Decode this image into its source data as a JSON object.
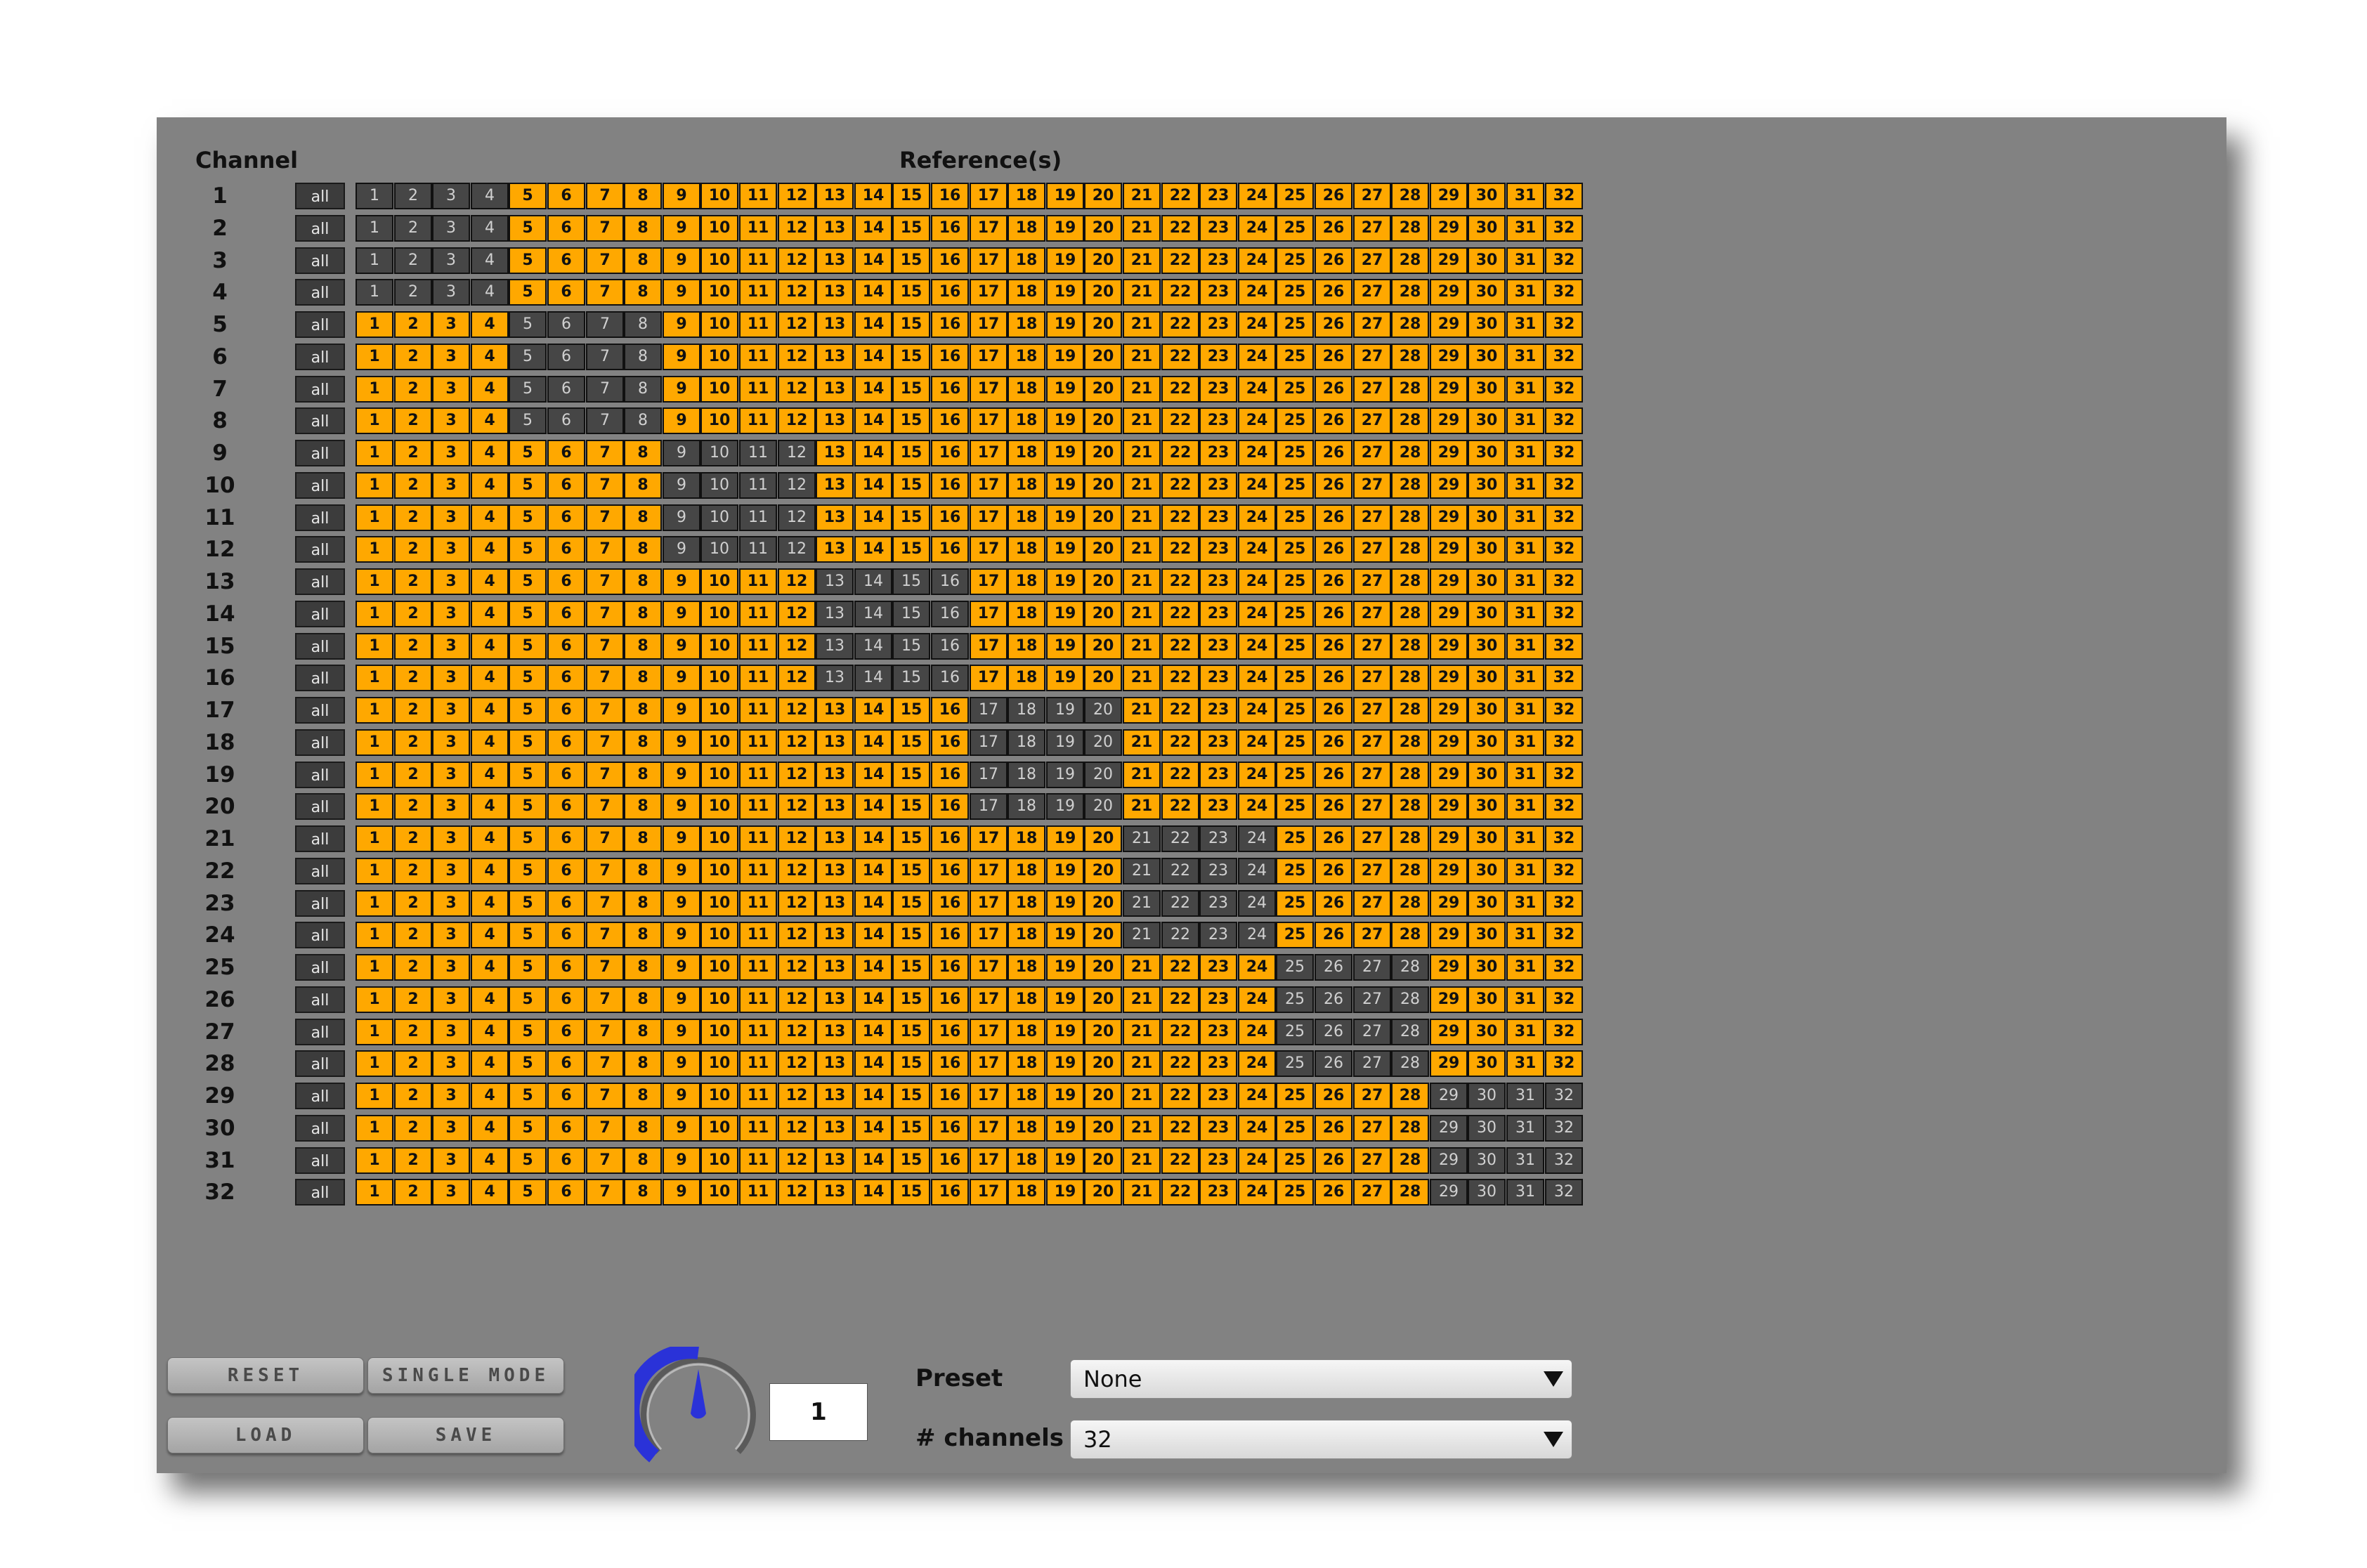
{
  "headers": {
    "channel": "Channel",
    "references": "Reference(s)"
  },
  "grid": {
    "num_channels": 32,
    "all_label": "all",
    "rows": [
      {
        "channel": "1",
        "off": [
          1,
          2,
          3,
          4
        ]
      },
      {
        "channel": "2",
        "off": [
          1,
          2,
          3,
          4
        ]
      },
      {
        "channel": "3",
        "off": [
          1,
          2,
          3,
          4
        ]
      },
      {
        "channel": "4",
        "off": [
          1,
          2,
          3,
          4
        ]
      },
      {
        "channel": "5",
        "off": [
          5,
          6,
          7,
          8
        ]
      },
      {
        "channel": "6",
        "off": [
          5,
          6,
          7,
          8
        ]
      },
      {
        "channel": "7",
        "off": [
          5,
          6,
          7,
          8
        ]
      },
      {
        "channel": "8",
        "off": [
          5,
          6,
          7,
          8
        ]
      },
      {
        "channel": "9",
        "off": [
          9,
          10,
          11,
          12
        ]
      },
      {
        "channel": "10",
        "off": [
          9,
          10,
          11,
          12
        ]
      },
      {
        "channel": "11",
        "off": [
          9,
          10,
          11,
          12
        ]
      },
      {
        "channel": "12",
        "off": [
          9,
          10,
          11,
          12
        ]
      },
      {
        "channel": "13",
        "off": [
          13,
          14,
          15,
          16
        ]
      },
      {
        "channel": "14",
        "off": [
          13,
          14,
          15,
          16
        ]
      },
      {
        "channel": "15",
        "off": [
          13,
          14,
          15,
          16
        ]
      },
      {
        "channel": "16",
        "off": [
          13,
          14,
          15,
          16
        ]
      },
      {
        "channel": "17",
        "off": [
          17,
          18,
          19,
          20
        ]
      },
      {
        "channel": "18",
        "off": [
          17,
          18,
          19,
          20
        ]
      },
      {
        "channel": "19",
        "off": [
          17,
          18,
          19,
          20
        ]
      },
      {
        "channel": "20",
        "off": [
          17,
          18,
          19,
          20
        ]
      },
      {
        "channel": "21",
        "off": [
          21,
          22,
          23,
          24
        ]
      },
      {
        "channel": "22",
        "off": [
          21,
          22,
          23,
          24
        ]
      },
      {
        "channel": "23",
        "off": [
          21,
          22,
          23,
          24
        ]
      },
      {
        "channel": "24",
        "off": [
          21,
          22,
          23,
          24
        ]
      },
      {
        "channel": "25",
        "off": [
          25,
          26,
          27,
          28
        ]
      },
      {
        "channel": "26",
        "off": [
          25,
          26,
          27,
          28
        ]
      },
      {
        "channel": "27",
        "off": [
          25,
          26,
          27,
          28
        ]
      },
      {
        "channel": "28",
        "off": [
          25,
          26,
          27,
          28
        ]
      },
      {
        "channel": "29",
        "off": [
          29,
          30,
          31,
          32
        ]
      },
      {
        "channel": "30",
        "off": [
          29,
          30,
          31,
          32
        ]
      },
      {
        "channel": "31",
        "off": [
          29,
          30,
          31,
          32
        ]
      },
      {
        "channel": "32",
        "off": [
          29,
          30,
          31,
          32
        ]
      }
    ]
  },
  "buttons": {
    "reset": "RESET",
    "single_mode": "SINGLE MODE",
    "load": "LOAD",
    "save": "SAVE"
  },
  "knob": {
    "value": "1"
  },
  "preset": {
    "label": "Preset",
    "value": "None"
  },
  "channels_select": {
    "label": "# channels",
    "value": "32"
  },
  "colors": {
    "on": "#ffa800",
    "off": "#464646",
    "panel": "#828282",
    "knob": "#2a32d8"
  }
}
